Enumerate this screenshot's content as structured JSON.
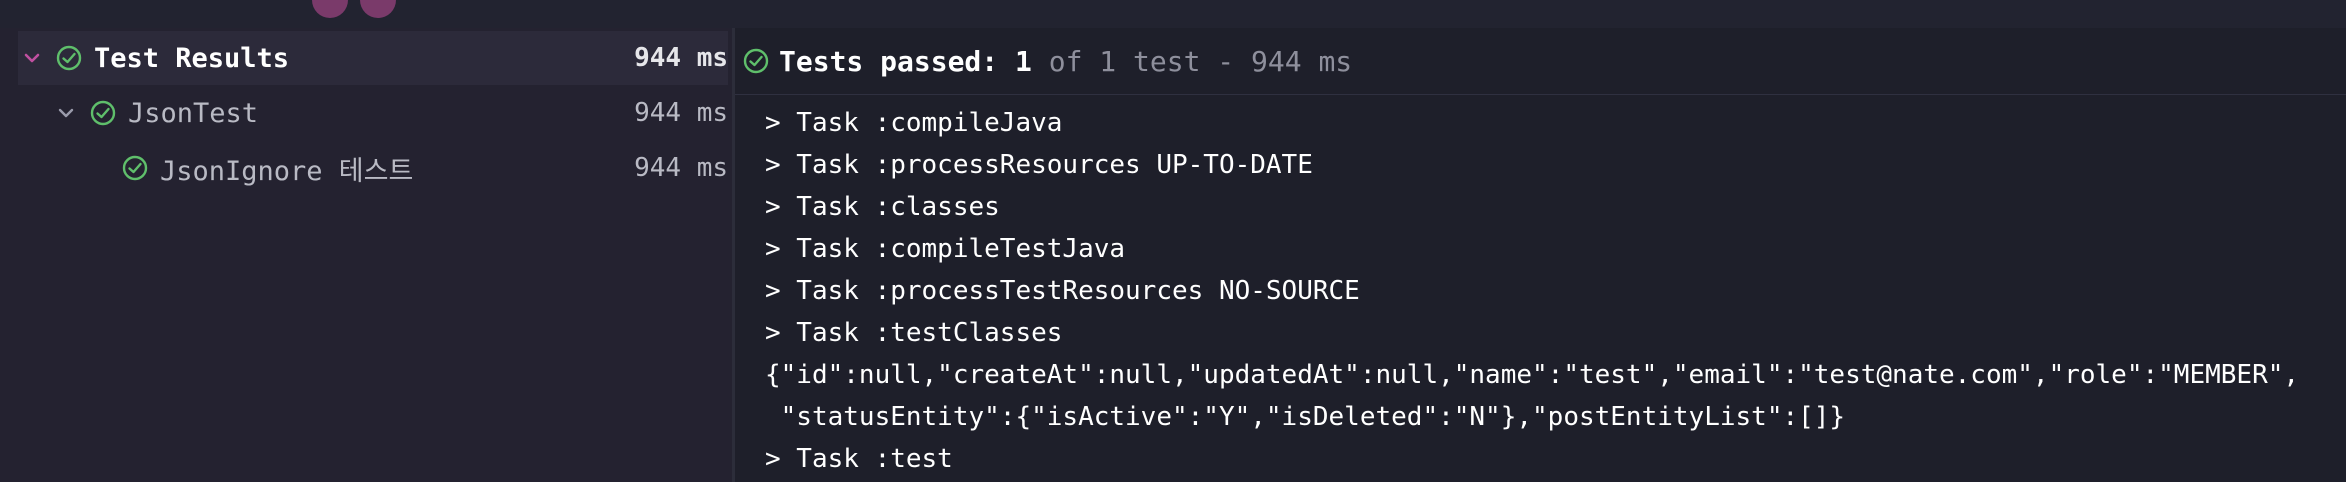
{
  "colors": {
    "pass_green": "#5fbf6b",
    "chevron_pink": "#c050a0",
    "background": "#1e1f2a",
    "left_pane": "#242230"
  },
  "tree": {
    "items": [
      {
        "label": "Test Results",
        "time": "944 ms",
        "icon": "check-circle-icon",
        "expanded": true,
        "selected": true
      },
      {
        "label": "JsonTest",
        "time": "944 ms",
        "icon": "check-circle-icon",
        "expanded": true
      },
      {
        "label": "JsonIgnore 테스트",
        "time": "944 ms",
        "icon": "check-circle-icon"
      }
    ]
  },
  "header": {
    "status_prefix": "Tests passed: ",
    "passed_count": "1",
    "summary": " of 1 test - 944 ms"
  },
  "console": {
    "lines": [
      "> Task :compileJava",
      "> Task :processResources UP-TO-DATE",
      "> Task :classes",
      "> Task :compileTestJava",
      "> Task :processTestResources NO-SOURCE",
      "> Task :testClasses",
      "{\"id\":null,\"createAt\":null,\"updatedAt\":null,\"name\":\"test\",\"email\":\"test@nate.com\",\"role\":\"MEMBER\",",
      " \"statusEntity\":{\"isActive\":\"Y\",\"isDeleted\":\"N\"},\"postEntityList\":[]}",
      "> Task :test"
    ]
  }
}
